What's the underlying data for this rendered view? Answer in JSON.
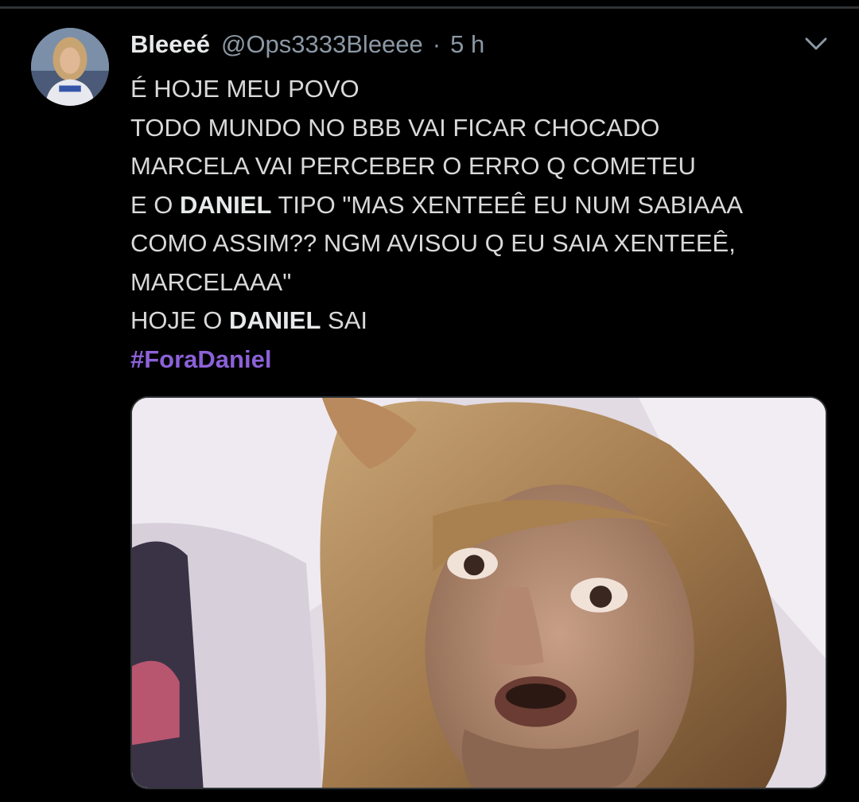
{
  "tweet": {
    "display_name": "Bleeeé",
    "handle": "@Ops3333Bleeee",
    "separator": "·",
    "timestamp": "5 h",
    "avatar_icon": "profile-photo",
    "menu_icon": "chevron-down-icon",
    "lines": [
      {
        "parts": [
          {
            "text": "É HOJE MEU POVO",
            "bold": false
          }
        ]
      },
      {
        "parts": [
          {
            "text": "TODO MUNDO NO BBB VAI FICAR CHOCADO",
            "bold": false
          }
        ]
      },
      {
        "parts": [
          {
            "text": "MARCELA VAI PERCEBER O ERRO Q COMETEU",
            "bold": false
          }
        ]
      },
      {
        "parts": [
          {
            "text": "E O ",
            "bold": false
          },
          {
            "text": "DANIEL",
            "bold": true
          },
          {
            "text": " TIPO \"MAS XENTEEÊ EU NUM SABIAAA",
            "bold": false
          }
        ]
      },
      {
        "parts": [
          {
            "text": "COMO ASSIM?? NGM AVISOU Q EU SAIA XENTEEÊ,",
            "bold": false
          }
        ]
      },
      {
        "parts": [
          {
            "text": "MARCELAAA\"",
            "bold": false
          }
        ]
      },
      {
        "parts": [
          {
            "text": "HOJE O ",
            "bold": false
          },
          {
            "text": "DANIEL",
            "bold": true
          },
          {
            "text": " SAI",
            "bold": false
          }
        ]
      }
    ],
    "hashtag": "#ForaDaniel",
    "media_kind": "photo"
  },
  "colors": {
    "background": "#000000",
    "text": "#d9d9d9",
    "secondary": "#8b98a5",
    "hashtag": "#8c61d8",
    "divider": "#2f3336"
  }
}
